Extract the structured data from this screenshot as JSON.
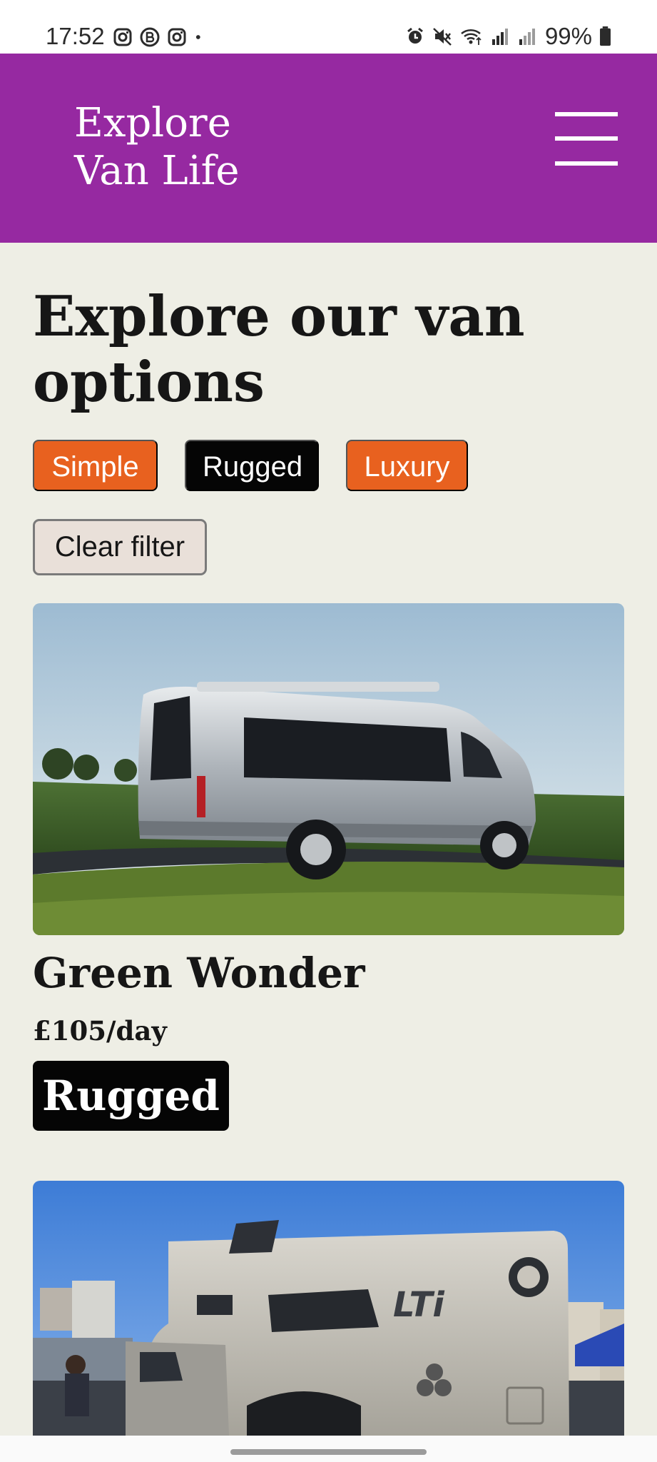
{
  "status_bar": {
    "time": "17:52",
    "left_icons": [
      "instagram-icon",
      "bereal-icon",
      "instagram-icon",
      "notification-dot-icon"
    ],
    "right_icons": [
      "alarm-icon",
      "mute-icon",
      "wifi-icon",
      "signal-icon",
      "signal-icon",
      "battery-icon"
    ],
    "battery": "99%"
  },
  "header": {
    "brand_line1": "Explore",
    "brand_line2": "Van Life",
    "menu_icon": "hamburger-menu-icon",
    "background": "#9629A1"
  },
  "main": {
    "title": "Explore our van options",
    "filters": [
      {
        "label": "Simple",
        "color": "#E8611F"
      },
      {
        "label": "Rugged",
        "color": "#050505"
      },
      {
        "label": "Luxury",
        "color": "#E8611F"
      }
    ],
    "clear_filter_label": "Clear filter"
  },
  "vans": [
    {
      "name": "Green Wonder",
      "price": "£105/day",
      "type": "Rugged",
      "image": "silver camper van on grassy hill"
    },
    {
      "image": "large silver expedition camper truck"
    }
  ]
}
